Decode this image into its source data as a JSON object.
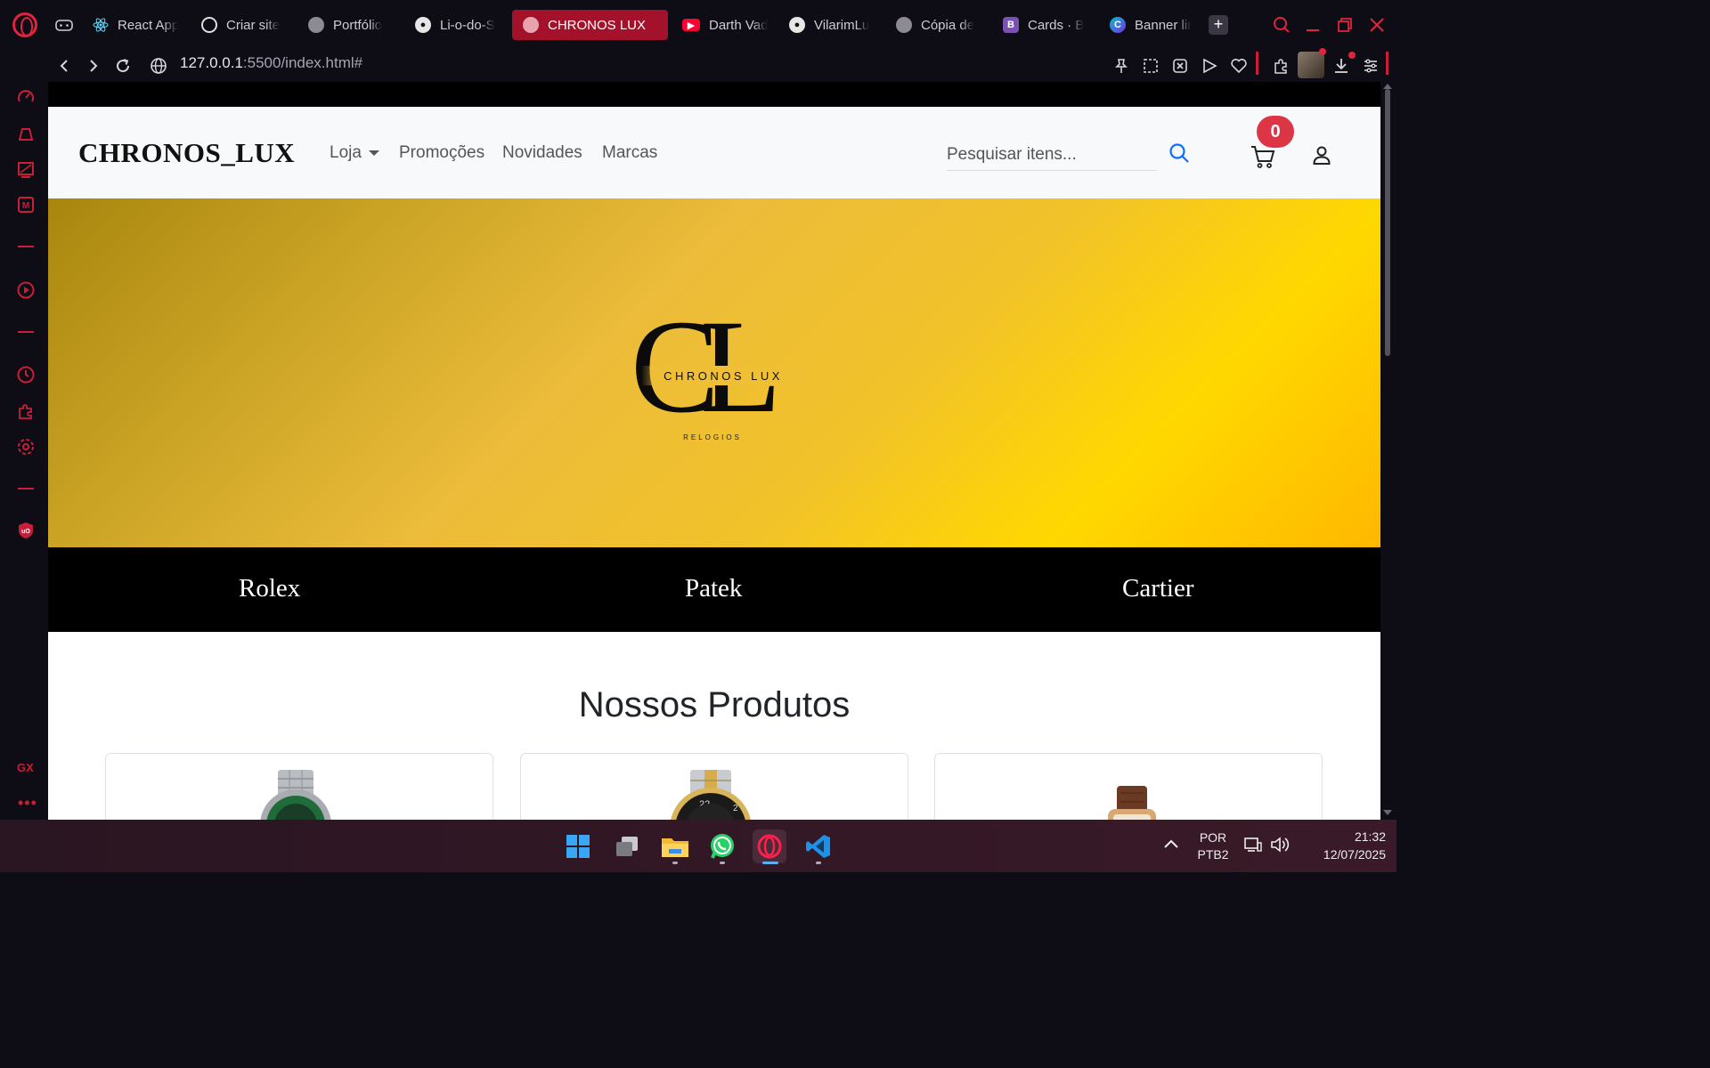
{
  "browser": {
    "tabs": [
      {
        "label": "React App",
        "icon": "react-icon"
      },
      {
        "label": "Criar site",
        "icon": "chatgpt-icon"
      },
      {
        "label": "Portfólio",
        "icon": "globe-icon"
      },
      {
        "label": "Li-o-do-S",
        "icon": "github-icon"
      },
      {
        "label": "CHRONOS LUX",
        "icon": "globe-icon",
        "active": true
      },
      {
        "label": "Darth Vad",
        "icon": "youtube-icon"
      },
      {
        "label": "VilarimLu",
        "icon": "github-icon"
      },
      {
        "label": "Cópia de",
        "icon": "globe-icon"
      },
      {
        "label": "Cards · B",
        "icon": "bootstrap-icon"
      },
      {
        "label": "Banner lir",
        "icon": "canva-icon"
      }
    ],
    "url_host": "127.0.0.1",
    "url_path": ":5500/index.html#",
    "accent": "#c81e3a"
  },
  "site": {
    "brand": "CHRONOS_LUX",
    "nav": {
      "shop": "Loja",
      "promos": "Promoções",
      "news": "Novidades",
      "brands": "Marcas"
    },
    "search_placeholder": "Pesquisar itens...",
    "cart_count": "0",
    "hero": {
      "logo_letters": "CL",
      "logo_name": "CHRONOS LUX",
      "logo_sub": "RELOGIOS"
    },
    "brand_bar": [
      "Rolex",
      "Patek",
      "Cartier"
    ],
    "section_title": "Nossos Produtos",
    "products": [
      {
        "image": "steel-green-dial-watch"
      },
      {
        "image": "two-tone-black-bezel-watch"
      },
      {
        "image": "brown-leather-strap-watch"
      }
    ]
  },
  "taskbar": {
    "apps": [
      "windows-start-icon",
      "task-view-icon",
      "file-explorer-icon",
      "whatsapp-icon",
      "opera-gx-icon",
      "vscode-icon"
    ],
    "lang_line1": "POR",
    "lang_line2": "PTB2",
    "time": "21:32",
    "date": "12/07/2025"
  }
}
